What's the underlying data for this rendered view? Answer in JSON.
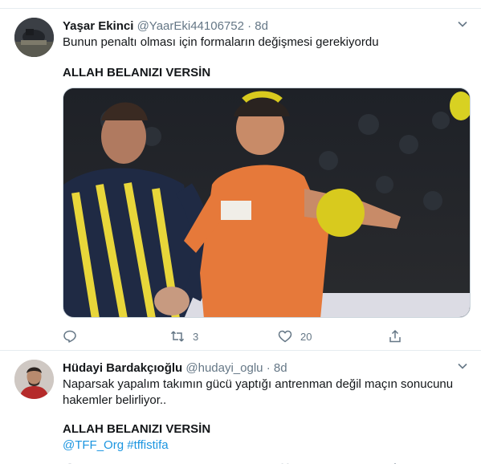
{
  "tweets": [
    {
      "author": "Yaşar Ekinci",
      "handle": "@YaarEki44106752",
      "dot": "·",
      "time": "8d",
      "text_line1": "Bunun penaltı olması için formaların değişmesi gerekiyordu",
      "text_line2": "ALLAH BELANIZI VERSİN",
      "actions": {
        "reply_count": "",
        "retweet_count": "3",
        "like_count": "20"
      },
      "icons": [
        "chevron-down-icon",
        "reply-icon",
        "retweet-icon",
        "like-icon",
        "share-icon"
      ]
    },
    {
      "author": "Hüdayi Bardakçıoğlu",
      "handle": "@hudayi_oglu",
      "dot": "·",
      "time": "8d",
      "text_line1": "Naparsak yapalım takımın gücü yaptığı antrenman değil maçın sonucunu",
      "text_line2": "hakemler belirliyor..",
      "text_line3": "ALLAH BELANIZI VERSİN",
      "text_line4": "@TFF_Org #tffistifa",
      "icons": [
        "chevron-down-icon",
        "reply-icon",
        "retweet-icon",
        "like-icon",
        "share-icon"
      ]
    }
  ],
  "colors": {
    "link": "#1b95e0",
    "muted": "#657786",
    "border": "#e6ecf0"
  }
}
